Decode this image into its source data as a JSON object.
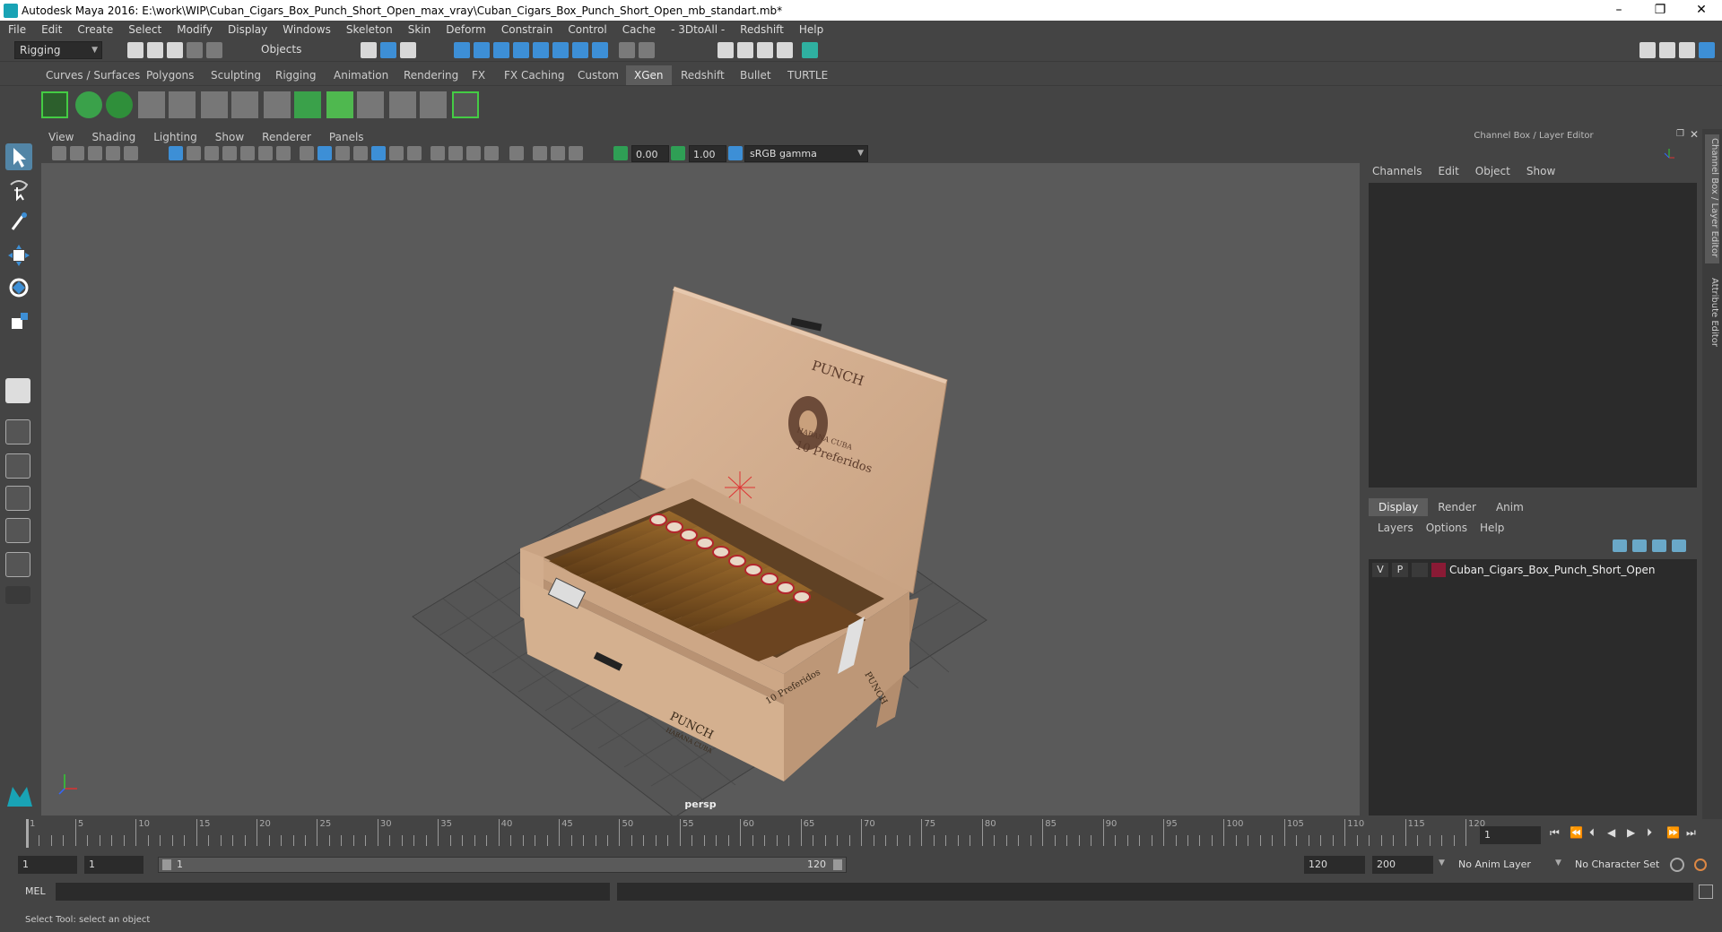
{
  "title": "Autodesk Maya 2016: E:\\work\\WIP\\Cuban_Cigars_Box_Punch_Short_Open_max_vray\\Cuban_Cigars_Box_Punch_Short_Open_mb_standart.mb*",
  "window_controls": [
    "–",
    "❐",
    "✕"
  ],
  "menubar": [
    "File",
    "Edit",
    "Create",
    "Select",
    "Modify",
    "Display",
    "Windows",
    "Skeleton",
    "Skin",
    "Deform",
    "Constrain",
    "Control",
    "Cache",
    "- 3DtoAll -",
    "Redshift",
    "Help"
  ],
  "status": {
    "mode": "Rigging",
    "selection_mode": "Objects"
  },
  "shelf_tabs": [
    "Curves / Surfaces",
    "Polygons",
    "Sculpting",
    "Rigging",
    "Animation",
    "Rendering",
    "FX",
    "FX Caching",
    "Custom",
    "XGen",
    "Redshift",
    "Bullet",
    "TURTLE"
  ],
  "shelf_active": "XGen",
  "viewport": {
    "menu": [
      "View",
      "Shading",
      "Lighting",
      "Show",
      "Renderer",
      "Panels"
    ],
    "exposure": "0.00",
    "gamma": "1.00",
    "color_space": "sRGB gamma",
    "camera_label": "persp"
  },
  "scene": {
    "lid_text_brand": "PUNCH",
    "lid_text_sub": "HABANA CUBA",
    "lid_text_count": "10 Preferidos",
    "front_text_brand": "PUNCH",
    "front_text_sub": "HABANA CUBA",
    "front_text_count": "10 Preferidos",
    "side_text": "PUNCH"
  },
  "channel_box": {
    "title": "Channel Box / Layer Editor",
    "menu": [
      "Channels",
      "Edit",
      "Object",
      "Show"
    ]
  },
  "layer_editor": {
    "tabs": [
      "Display",
      "Render",
      "Anim"
    ],
    "active_tab": "Display",
    "menu": [
      "Layers",
      "Options",
      "Help"
    ],
    "layers": [
      {
        "v": "V",
        "p": "P",
        "name": "Cuban_Cigars_Box_Punch_Short_Open",
        "color": "#8a1a35"
      }
    ]
  },
  "side_tabs": [
    "Channel Box / Layer Editor",
    "Attribute Editor"
  ],
  "timeline": {
    "labels": [
      "1",
      "5",
      "10",
      "15",
      "20",
      "25",
      "30",
      "35",
      "40",
      "45",
      "50",
      "55",
      "60",
      "65",
      "70",
      "75",
      "80",
      "85",
      "90",
      "95",
      "100",
      "105",
      "110",
      "115",
      "120"
    ],
    "current_frame": "1"
  },
  "range": {
    "start": "1",
    "start_inner": "1",
    "slider_start": "1",
    "slider_end": "120",
    "end_inner": "120",
    "end": "200",
    "anim_layer": "No Anim Layer",
    "char_set": "No Character Set"
  },
  "command": {
    "label": "MEL"
  },
  "help_line": "Select Tool: select an object"
}
